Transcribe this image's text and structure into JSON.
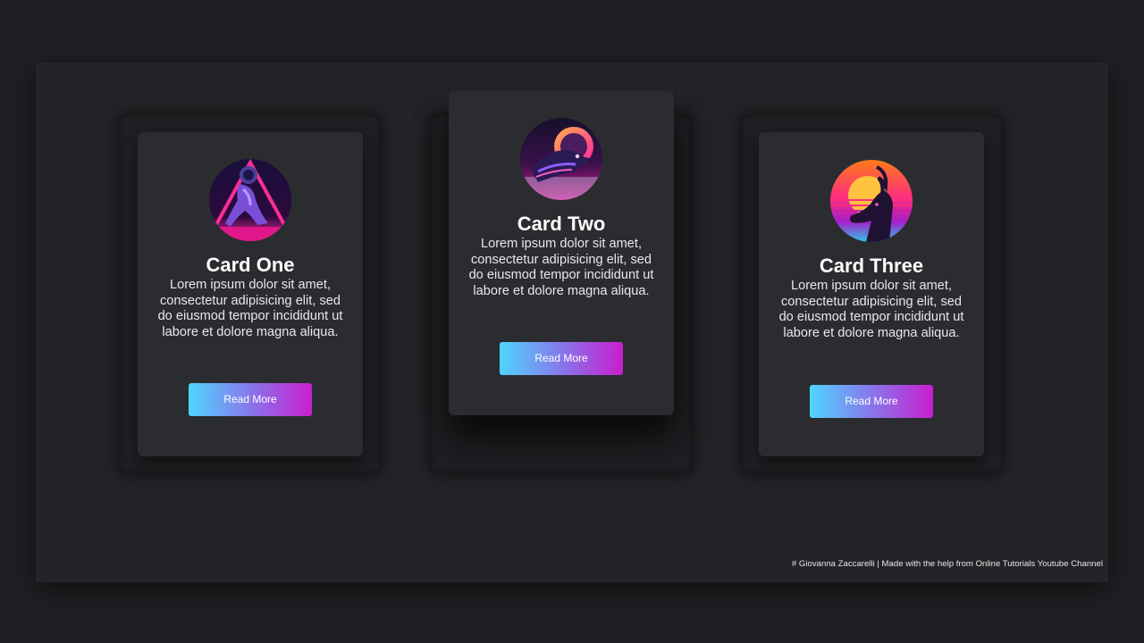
{
  "cards": [
    {
      "title": "Card One",
      "text": "Lorem ipsum dolor sit amet, consectetur adipisicing elit, sed do eiusmod tempor incididunt ut labore et dolore magna aliqua.",
      "button_label": "Read More",
      "image_icon": "astronaut-panther-icon"
    },
    {
      "title": "Card Two",
      "text": "Lorem ipsum dolor sit amet, consectetur adipisicing elit, sed do eiusmod tempor incididunt ut labore et dolore magna aliqua.",
      "button_label": "Read More",
      "image_icon": "crow-icon"
    },
    {
      "title": "Card Three",
      "text": "Lorem ipsum dolor sit amet, consectetur adipisicing elit, sed do eiusmod tempor incididunt ut labore et dolore magna aliqua.",
      "button_label": "Read More",
      "image_icon": "antelope-icon"
    }
  ],
  "footer": {
    "credit": "# Giovanna Zaccarelli | Made with the help from Online Tutorials Youtube Channel"
  },
  "colors": {
    "background": "#1f2023",
    "stage": "#232427",
    "card": "#2b2c30",
    "button_gradient_start": "#4fd5ff",
    "button_gradient_end": "#c81fcf"
  }
}
